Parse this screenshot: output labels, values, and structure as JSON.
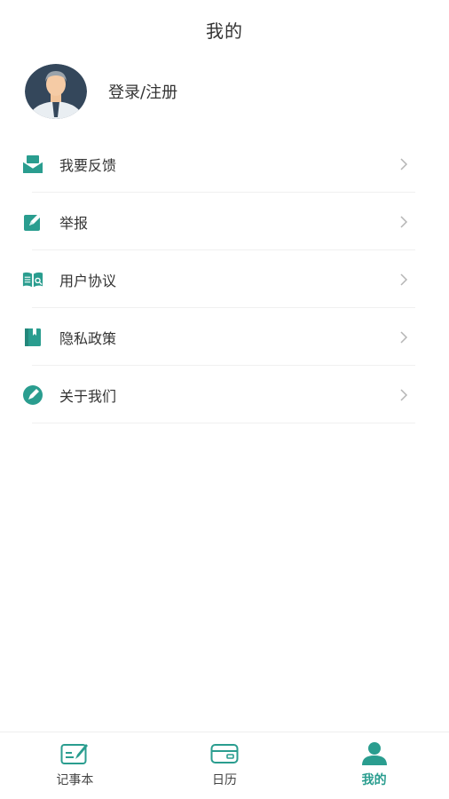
{
  "header": {
    "title": "我的"
  },
  "profile": {
    "login_text": "登录/注册",
    "avatar_icon": "user-avatar-icon"
  },
  "menu": [
    {
      "label": "我要反馈",
      "icon": "feedback-mail-icon"
    },
    {
      "label": "举报",
      "icon": "report-pencil-icon"
    },
    {
      "label": "用户协议",
      "icon": "agreement-book-icon"
    },
    {
      "label": "隐私政策",
      "icon": "privacy-book-icon"
    },
    {
      "label": "关于我们",
      "icon": "about-circle-icon"
    }
  ],
  "tabbar": {
    "tabs": [
      {
        "label": "记事本",
        "icon": "notebook-icon",
        "active": false
      },
      {
        "label": "日历",
        "icon": "calendar-card-icon",
        "active": false
      },
      {
        "label": "我的",
        "icon": "person-icon",
        "active": true
      }
    ]
  },
  "colors": {
    "accent": "#2a9d8f",
    "text": "#333333",
    "divider": "#f0f0f0"
  }
}
